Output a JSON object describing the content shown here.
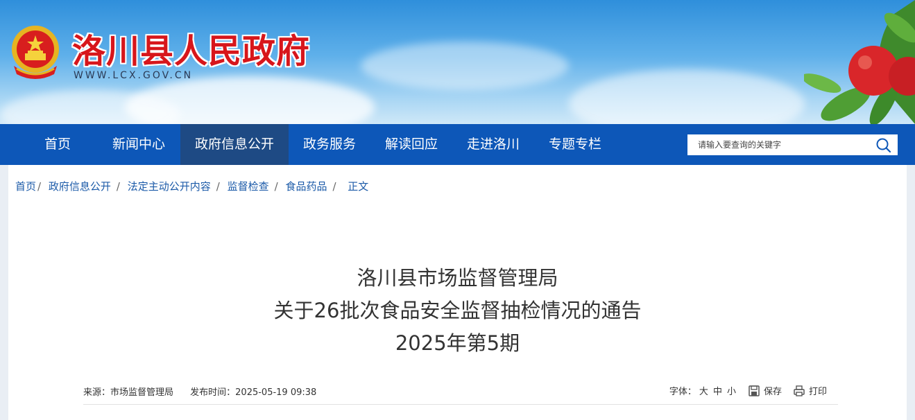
{
  "header": {
    "site_title": "洛川县人民政府",
    "site_url": "WWW.LCX.GOV.CN"
  },
  "nav": {
    "items": [
      {
        "label": "首页"
      },
      {
        "label": "新闻中心"
      },
      {
        "label": "政府信息公开"
      },
      {
        "label": "政务服务"
      },
      {
        "label": "解读回应"
      },
      {
        "label": "走进洛川"
      },
      {
        "label": "专题专栏"
      }
    ],
    "active_index": 2
  },
  "search": {
    "placeholder": "请输入要查询的关键字"
  },
  "breadcrumb": {
    "items": [
      "首页",
      "政府信息公开",
      "法定主动公开内容",
      "监督检查",
      "食品药品",
      "正文"
    ],
    "separator": "/"
  },
  "article": {
    "title_lines": [
      "洛川县市场监督管理局",
      "关于26批次食品安全监督抽检情况的通告",
      "2025年第5期"
    ],
    "source": "来源：市场监督管理局",
    "publish_time": "发布时间：2025-05-19 09:38"
  },
  "tools": {
    "font_label": "字体：",
    "font_large": "大",
    "font_medium": "中",
    "font_small": "小",
    "save_label": "保存",
    "print_label": "打印"
  },
  "colors": {
    "nav_bg": "#0d57b8",
    "nav_active_bg": "#1e4a84",
    "title_red": "#d7161b",
    "link_blue": "#1b5aa8"
  }
}
